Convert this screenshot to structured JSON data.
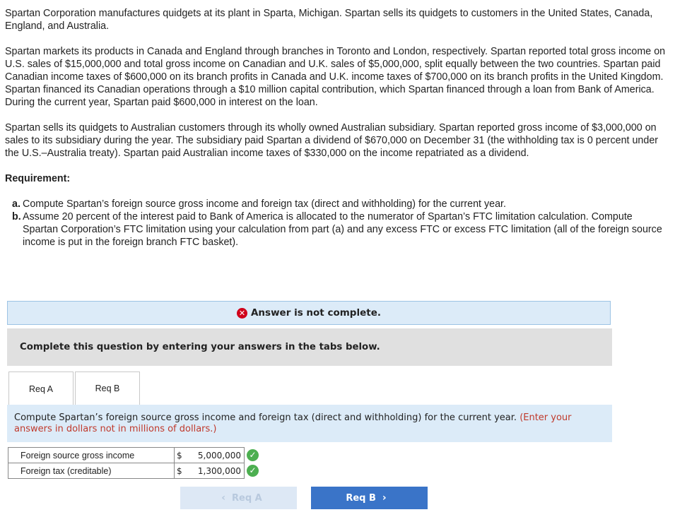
{
  "problem": {
    "paragraphs": [
      "Spartan Corporation manufactures quidgets at its plant in Sparta, Michigan. Spartan sells its quidgets to customers in the United States, Canada, England, and Australia.",
      "Spartan markets its products in Canada and England through branches in Toronto and London, respectively. Spartan reported total gross income on U.S. sales of $15,000,000 and total gross income on Canadian and U.K. sales of $5,000,000, split equally between the two countries. Spartan paid Canadian income taxes of $600,000 on its branch profits in Canada and U.K. income taxes of $700,000 on its branch profits in the United Kingdom. Spartan financed its Canadian operations through a $10 million capital contribution, which Spartan financed through a loan from Bank of America. During the current year, Spartan paid $600,000 in interest on the loan.",
      "Spartan sells its quidgets to Australian customers through its wholly owned Australian subsidiary. Spartan reported gross income of $3,000,000 on sales to its subsidiary during the year. The subsidiary paid Spartan a dividend of $670,000 on December 31 (the withholding tax is 0 percent under the U.S.–Australia treaty). Spartan paid Australian income taxes of $330,000 on the income repatriated as a dividend."
    ],
    "requirement_heading": "Requirement:",
    "requirements": [
      {
        "letter": "a.",
        "text": "Compute Spartan’s foreign source gross income and foreign tax (direct and withholding) for the current year."
      },
      {
        "letter": "b.",
        "text": "Assume 20 percent of the interest paid to Bank of America is allocated to the numerator of Spartan’s FTC limitation calculation. Compute Spartan Corporation’s FTC limitation using your calculation from part (a) and any excess FTC or excess FTC limitation (all of the foreign source income is put in the foreign branch FTC basket)."
      }
    ]
  },
  "alert": {
    "text": "Answer is not complete.",
    "icon": "x-circle-icon",
    "color": "#d0021b"
  },
  "instruction_bar": "Complete this question by entering your answers in the tabs below.",
  "tabs": [
    {
      "label": "Req A",
      "active": true
    },
    {
      "label": "Req B",
      "active": false
    }
  ],
  "req_a": {
    "instruction": "Compute Spartan’s foreign source gross income and foreign tax (direct and withholding) for the current year.",
    "note": "(Enter your answers in dollars not in millions of dollars.)",
    "rows": [
      {
        "label": "Foreign source gross income",
        "currency": "$",
        "value": "5,000,000",
        "status": "correct"
      },
      {
        "label": "Foreign tax (creditable)",
        "currency": "$",
        "value": "1,300,000",
        "status": "correct"
      }
    ]
  },
  "nav": {
    "prev_label": "Req A",
    "next_label": "Req B",
    "prev_chevron": "‹",
    "next_chevron": "›"
  }
}
